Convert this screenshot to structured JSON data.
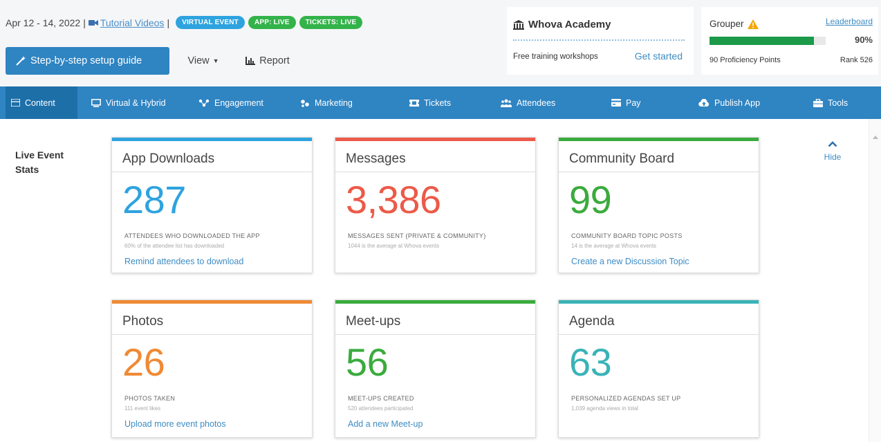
{
  "header": {
    "date_range": "Apr 12 - 14, 2022",
    "sep1": "|",
    "tutorial_link": "Tutorial Videos",
    "sep2": "|",
    "badges": [
      "VIRTUAL EVENT",
      "APP: LIVE",
      "TICKETS: LIVE"
    ],
    "setup_guide_label": "Step-by-step setup guide",
    "view_label": "View",
    "report_label": "Report"
  },
  "academy": {
    "title": "Whova Academy",
    "subtitle": "Free training workshops",
    "cta": "Get started"
  },
  "grouper": {
    "label": "Grouper",
    "leaderboard_link": "Leaderboard",
    "progress_text": "90%",
    "progress_value": 0.9,
    "points": "90 Proficiency Points",
    "rank": "Rank 526"
  },
  "nav": {
    "items": [
      {
        "label": "Content",
        "icon": "content-icon"
      },
      {
        "label": "Virtual & Hybrid",
        "icon": "monitor-icon"
      },
      {
        "label": "Engagement",
        "icon": "engagement-icon"
      },
      {
        "label": "Marketing",
        "icon": "marketing-icon"
      },
      {
        "label": "Tickets",
        "icon": "ticket-icon"
      },
      {
        "label": "Attendees",
        "icon": "attendees-icon"
      },
      {
        "label": "Pay",
        "icon": "pay-icon"
      },
      {
        "label": "Publish App",
        "icon": "cloud-upload-icon"
      },
      {
        "label": "Tools",
        "icon": "toolbox-icon"
      }
    ]
  },
  "stats": {
    "section_label_line1": "Live Event",
    "section_label_line2": "Stats",
    "hide_label": "Hide",
    "cards": [
      {
        "title": "App Downloads",
        "value": "287",
        "desc": "ATTENDEES WHO DOWNLOADED THE APP",
        "sub": "60% of the attendee list has downloaded",
        "link": "Remind attendees to download"
      },
      {
        "title": "Messages",
        "value": "3,386",
        "desc": "MESSAGES SENT (PRIVATE & COMMUNITY)",
        "sub": "1044 is the average at Whova events",
        "link": ""
      },
      {
        "title": "Community Board",
        "value": "99",
        "desc": "COMMUNITY BOARD TOPIC POSTS",
        "sub": "14 is the average at Whova events",
        "link": "Create a new Discussion Topic"
      },
      {
        "title": "Photos",
        "value": "26",
        "desc": "PHOTOS TAKEN",
        "sub": "111 event likes",
        "link": "Upload more event photos"
      },
      {
        "title": "Meet-ups",
        "value": "56",
        "desc": "MEET-UPS CREATED",
        "sub": "520 attendees participated",
        "link": "Add a new Meet-up"
      },
      {
        "title": "Agenda",
        "value": "63",
        "desc": "PERSONALIZED AGENDAS SET UP",
        "sub": "1,039 agenda views in total",
        "link": ""
      }
    ]
  },
  "colors": {
    "primary": "#2f84c2",
    "nav_active": "#1d6fa8",
    "card_blue": "#2ea3df",
    "card_red": "#ec5a48",
    "card_green": "#3aab3d",
    "card_orange": "#ef8a35",
    "card_teal": "#3ab3b8",
    "badge_green": "#33b34a",
    "progress_green": "#1c9a4a",
    "warning": "#f4a600"
  }
}
